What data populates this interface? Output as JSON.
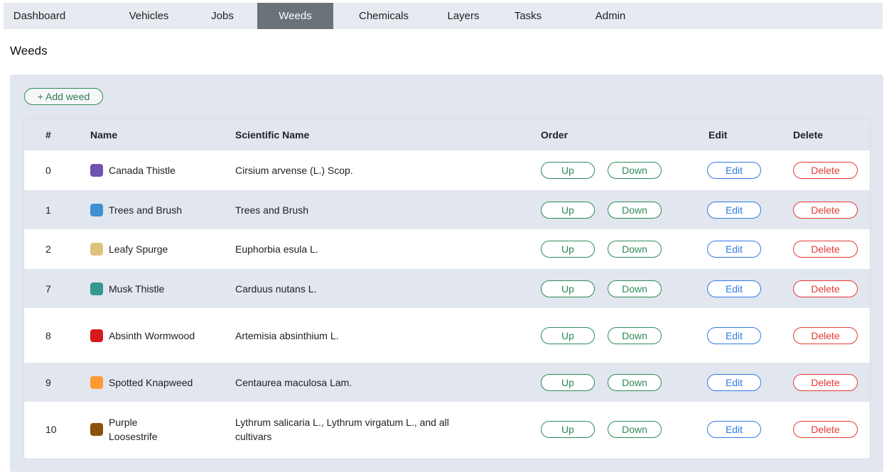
{
  "nav": {
    "items": [
      {
        "label": "Dashboard"
      },
      {
        "label": "Vehicles"
      },
      {
        "label": "Jobs"
      },
      {
        "label": "Weeds"
      },
      {
        "label": "Chemicals"
      },
      {
        "label": "Layers"
      },
      {
        "label": "Tasks"
      },
      {
        "label": "Admin"
      }
    ],
    "active": "Weeds"
  },
  "page": {
    "title": "Weeds",
    "add_label": "+ Add weed"
  },
  "table": {
    "headers": {
      "num": "#",
      "name": "Name",
      "scientific": "Scientific Name",
      "order": "Order",
      "edit": "Edit",
      "delete": "Delete"
    },
    "button_labels": {
      "up": "Up",
      "down": "Down",
      "edit": "Edit",
      "delete": "Delete"
    },
    "rows": [
      {
        "num": "0",
        "name": "Canada Thistle",
        "scientific": "Cirsium arvense (L.) Scop.",
        "color": "#7052b0"
      },
      {
        "num": "1",
        "name": "Trees and Brush",
        "scientific": "Trees and Brush",
        "color": "#3f8fd2"
      },
      {
        "num": "2",
        "name": "Leafy Spurge",
        "scientific": "Euphorbia esula L.",
        "color": "#dfc27d"
      },
      {
        "num": "7",
        "name": "Musk Thistle",
        "scientific": "Carduus nutans L.",
        "color": "#35978f"
      },
      {
        "num": "8",
        "name": "Absinth Wormwood",
        "scientific": "Artemisia absinthium L.",
        "color": "#d7191c"
      },
      {
        "num": "9",
        "name": "Spotted Knapweed",
        "scientific": "Centaurea maculosa Lam.",
        "color": "#fd9a33"
      },
      {
        "num": "10",
        "name": "Purple Loosestrife",
        "scientific": "Lythrum salicaria L., Lythrum virgatum L., and all cultivars",
        "color": "#8c510a"
      }
    ]
  }
}
